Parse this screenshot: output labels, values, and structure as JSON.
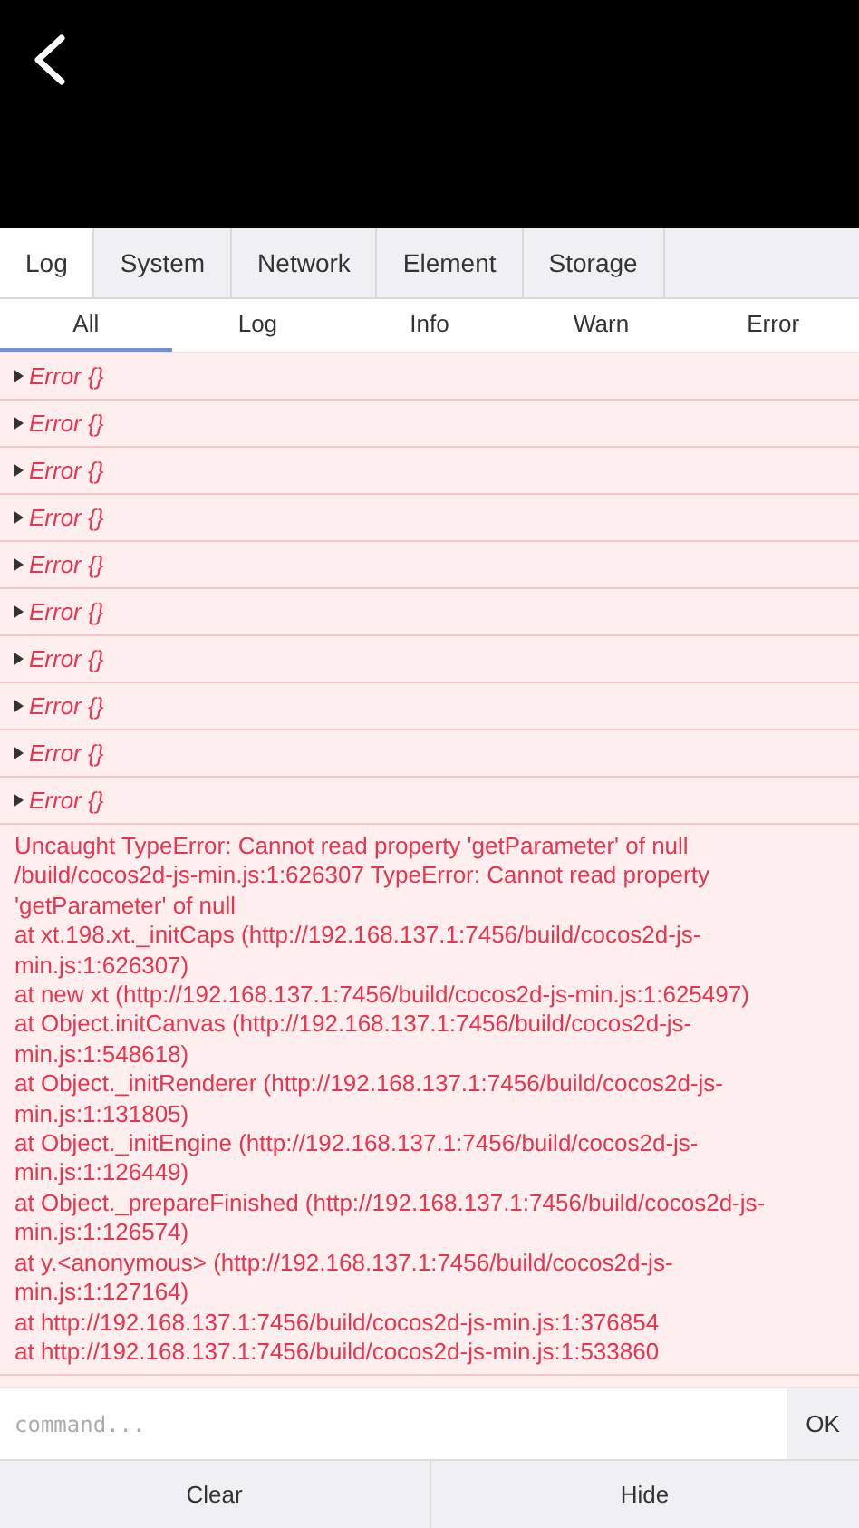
{
  "tabs": [
    {
      "label": "Log",
      "selected": true
    },
    {
      "label": "System",
      "selected": false
    },
    {
      "label": "Network",
      "selected": false
    },
    {
      "label": "Element",
      "selected": false
    },
    {
      "label": "Storage",
      "selected": false
    }
  ],
  "filters": [
    {
      "label": "All",
      "selected": true
    },
    {
      "label": "Log",
      "selected": false
    },
    {
      "label": "Info",
      "selected": false
    },
    {
      "label": "Warn",
      "selected": false
    },
    {
      "label": "Error",
      "selected": false
    }
  ],
  "log_rows": [
    {
      "text": "Error {}",
      "expanded": false
    },
    {
      "text": "Error {}",
      "expanded": false
    },
    {
      "text": "Error {}",
      "expanded": false
    },
    {
      "text": "Error {}",
      "expanded": false
    },
    {
      "text": "Error {}",
      "expanded": false
    },
    {
      "text": "Error {}",
      "expanded": false
    },
    {
      "text": "Error {}",
      "expanded": false
    },
    {
      "text": "Error {}",
      "expanded": false
    },
    {
      "text": "Error {}",
      "expanded": false
    },
    {
      "text": "Error {}",
      "expanded": false
    }
  ],
  "error_message": "Uncaught TypeError: Cannot read property 'getParameter' of null /build/cocos2d-js-min.js:1:626307 TypeError: Cannot read property 'getParameter' of null\nat xt.198.xt._initCaps (http://192.168.137.1:7456/build/cocos2d-js-min.js:1:626307)\nat new xt (http://192.168.137.1:7456/build/cocos2d-js-min.js:1:625497)\nat Object.initCanvas (http://192.168.137.1:7456/build/cocos2d-js-min.js:1:548618)\nat Object._initRenderer (http://192.168.137.1:7456/build/cocos2d-js-min.js:1:131805)\nat Object._initEngine (http://192.168.137.1:7456/build/cocos2d-js-min.js:1:126449)\nat Object._prepareFinished (http://192.168.137.1:7456/build/cocos2d-js-min.js:1:126574)\nat y.<anonymous> (http://192.168.137.1:7456/build/cocos2d-js-min.js:1:127164)\nat http://192.168.137.1:7456/build/cocos2d-js-min.js:1:376854\nat http://192.168.137.1:7456/build/cocos2d-js-min.js:1:533860",
  "command": {
    "placeholder": "command...",
    "button": "OK"
  },
  "footer_buttons": [
    "Clear",
    "Hide"
  ]
}
